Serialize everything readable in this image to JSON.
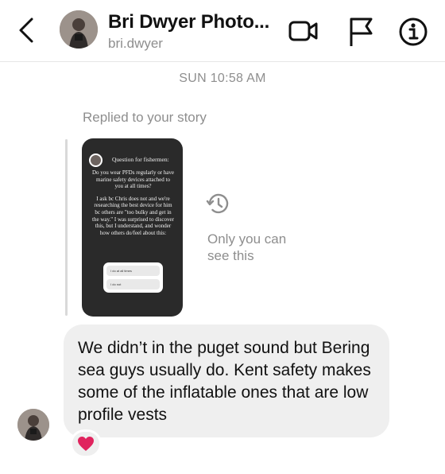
{
  "header": {
    "title": "Bri Dwyer Photo...",
    "username": "bri.dwyer",
    "icons": [
      "back-icon",
      "video-call-icon",
      "flag-icon",
      "info-icon"
    ]
  },
  "thread": {
    "timestamp": "SUN 10:58 AM",
    "reply_label": "Replied to your story",
    "story": {
      "question": "Question for fishermen:",
      "body_1": "Do you wear PFDs regularly or have marine safety devices attached to you at all times?",
      "body_2": "I ask bc Chris does not and we're researching the best device for him bc others are \"too bulky and get in the way.\" I was surprised to discover this, but I understand, and wonder how others do/feel about this:",
      "poll_options": [
        "I do at all times",
        "I do not"
      ]
    },
    "expired_text": "Only you can see this",
    "message": "We didn’t in the puget sound but Bering sea guys usually do. Kent safety makes some of the inflatable ones that are low profile vests",
    "reaction": "❤️"
  },
  "colors": {
    "secondary_text": "#8e8e8e",
    "bubble_bg": "#efefef",
    "story_bg": "#2a2a2a",
    "heart": "#e0245e"
  }
}
